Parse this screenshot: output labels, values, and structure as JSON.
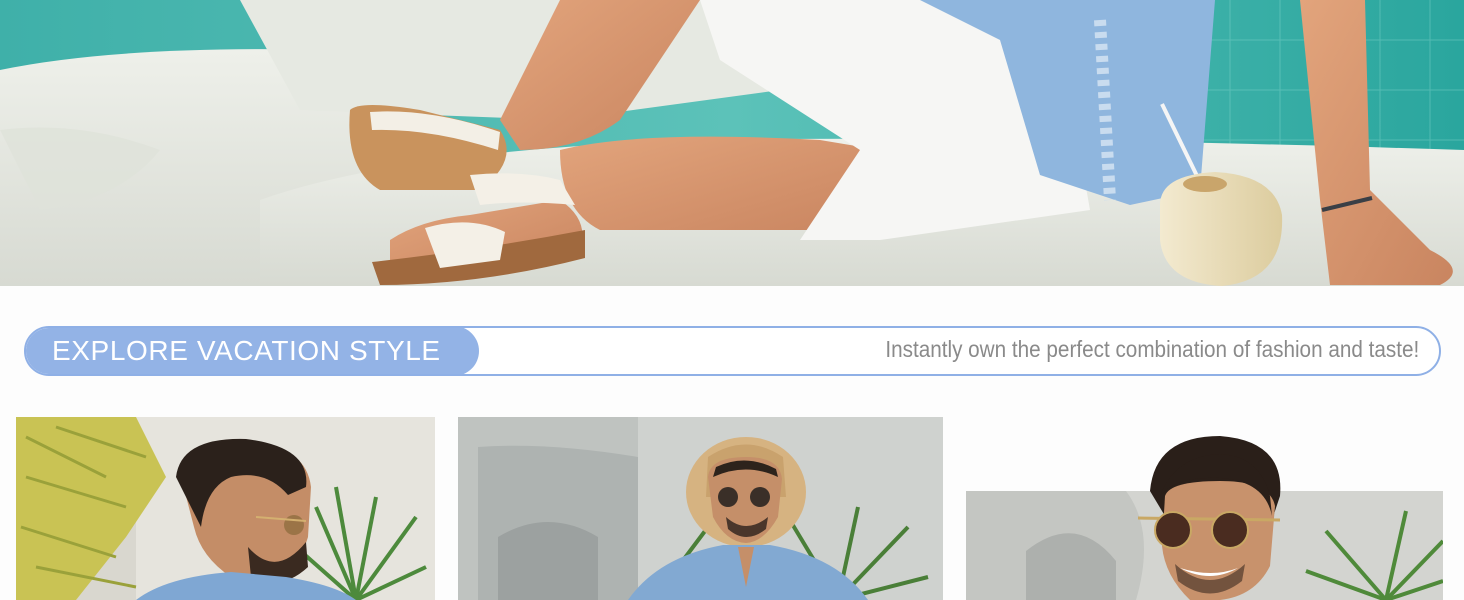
{
  "banner": {
    "title": "EXPLORE VACATION STYLE",
    "tagline": "Instantly own the perfect combination of fashion and taste!"
  },
  "colors": {
    "accent_blue": "#93b3e6",
    "banner_border": "#8fb0e6",
    "tagline_gray": "#8a8a8a",
    "pool_teal": "#46b3ad",
    "shirt_blue": "#8fb6de"
  },
  "images": {
    "hero": "hero-vacation-photo",
    "photos": [
      "model-side-view-photo",
      "model-straw-hat-photo",
      "model-sunglasses-closeup-photo"
    ]
  }
}
